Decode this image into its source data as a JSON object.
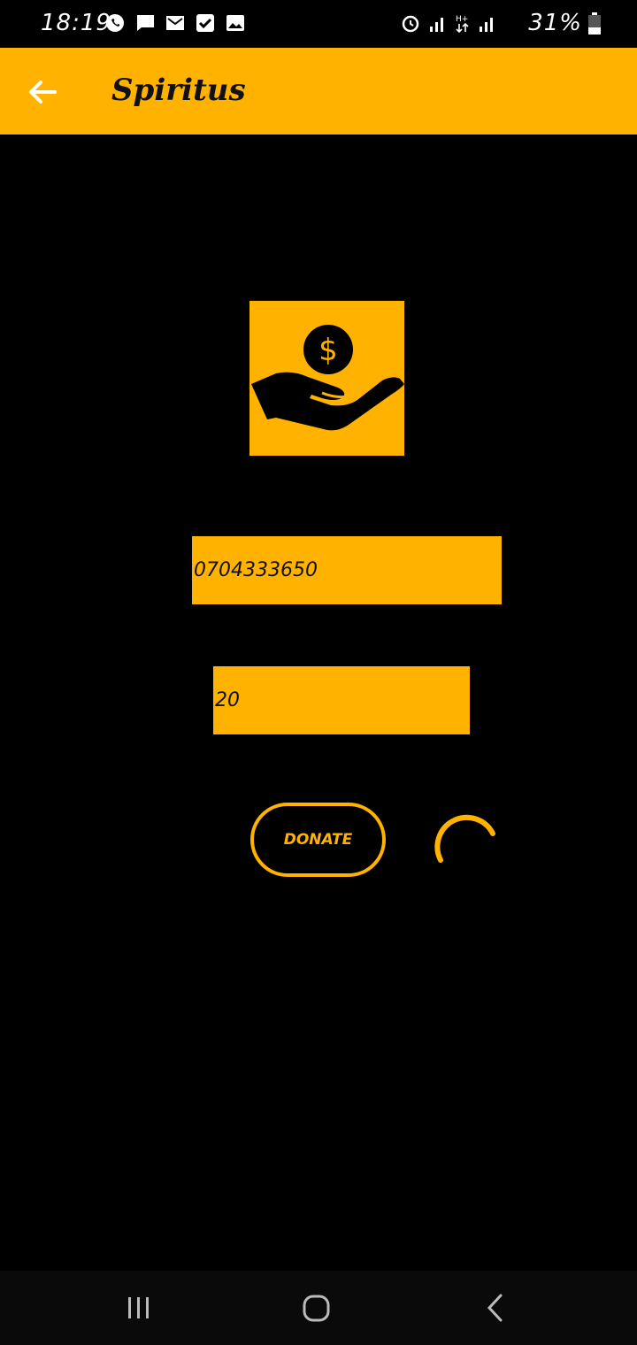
{
  "status_bar": {
    "time": "18:19",
    "battery_text": "31%",
    "icons_left": [
      "whatsapp-icon",
      "message-icon",
      "gmail-icon",
      "check-icon",
      "image-icon"
    ],
    "icons_right": [
      "alarm-icon",
      "signal-icon",
      "data-icon",
      "signal-icon",
      "battery-icon"
    ]
  },
  "app_bar": {
    "title": "Spiritus",
    "back_icon": "arrow-left-icon",
    "color": "#FFB300"
  },
  "main": {
    "logo_icon": "hand-dollar-icon",
    "phone_field": {
      "value": "0704333650"
    },
    "amount_field": {
      "value": "20"
    },
    "donate_button": {
      "label": "DONATE"
    },
    "loading_icon": "spinner-icon"
  },
  "nav_bar": {
    "icons": [
      "recents-icon",
      "home-icon",
      "back-icon"
    ]
  }
}
